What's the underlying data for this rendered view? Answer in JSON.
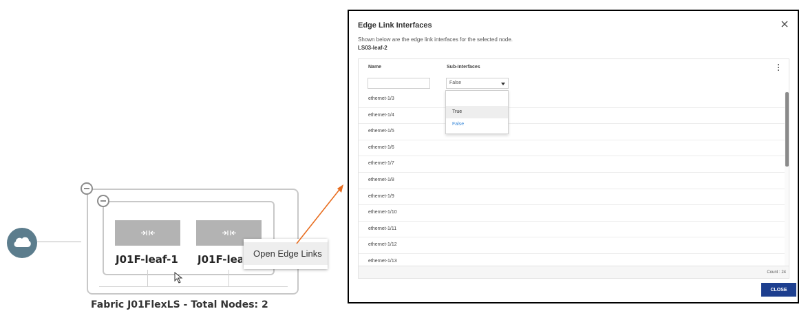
{
  "colors": {
    "cloud": "#5c7d8d",
    "node_fill": "#b3b3b3",
    "arrow": "#e86d1f",
    "primary_button": "#1d3f8f",
    "link_blue": "#3b8ad9"
  },
  "topology": {
    "cloud_icon": "cloud-icon",
    "nodes": [
      {
        "label": "J01F-leaf-1",
        "icon": "switch-arrows-icon"
      },
      {
        "label": "J01F-leaf-",
        "icon": "switch-arrows-icon"
      }
    ],
    "fabric_caption": "Fabric J01FlexLS - Total Nodes: 2"
  },
  "context_menu": {
    "items": [
      {
        "label": "Open Edge Links"
      }
    ]
  },
  "modal": {
    "title": "Edge Link Interfaces",
    "description": "Shown below are the edge link interfaces for the selected node.",
    "node_name": "LS03-leaf-2",
    "close_icon": "close-icon",
    "columns": {
      "name": "Name",
      "sub_interfaces": "Sub-Interfaces"
    },
    "filters": {
      "name_value": "",
      "sub_value": "False"
    },
    "dropdown_options": [
      "True",
      "False"
    ],
    "rows": [
      "ethernet-1/3",
      "ethernet-1/4",
      "ethernet-1/5",
      "ethernet-1/6",
      "ethernet-1/7",
      "ethernet-1/8",
      "ethernet-1/9",
      "ethernet-1/10",
      "ethernet-1/11",
      "ethernet-1/12",
      "ethernet-1/13"
    ],
    "count_text": "Count : 24",
    "close_button": "CLOSE"
  }
}
